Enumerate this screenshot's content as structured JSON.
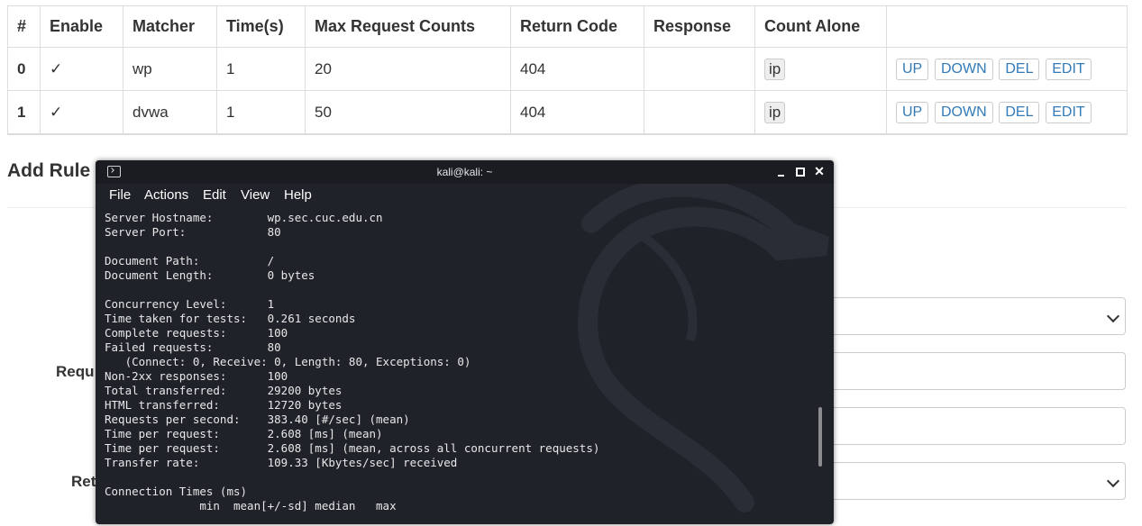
{
  "rules_table": {
    "headers": [
      "#",
      "Enable",
      "Matcher",
      "Time(s)",
      "Max Request Counts",
      "Return Code",
      "Response",
      "Count Alone",
      ""
    ],
    "rows": [
      {
        "index": "0",
        "enable": "✓",
        "matcher": "wp",
        "time": "1",
        "max_requests": "20",
        "return_code": "404",
        "response": "",
        "count_alone": "ip"
      },
      {
        "index": "1",
        "enable": "✓",
        "matcher": "dvwa",
        "time": "1",
        "max_requests": "50",
        "return_code": "404",
        "response": "",
        "count_alone": "ip"
      }
    ],
    "actions": {
      "up": "UP",
      "down": "DOWN",
      "del": "DEL",
      "edit": "EDIT"
    }
  },
  "form": {
    "title": "Add Rule",
    "label_request_partial": "Requ",
    "label_return_partial": "Ret"
  },
  "terminal": {
    "title": "kali@kali: ~",
    "menu": [
      "File",
      "Actions",
      "Edit",
      "View",
      "Help"
    ],
    "lines": [
      "Server Hostname:        wp.sec.cuc.edu.cn",
      "Server Port:            80",
      "",
      "Document Path:          /",
      "Document Length:        0 bytes",
      "",
      "Concurrency Level:      1",
      "Time taken for tests:   0.261 seconds",
      "Complete requests:      100",
      "Failed requests:        80",
      "   (Connect: 0, Receive: 0, Length: 80, Exceptions: 0)",
      "Non-2xx responses:      100",
      "Total transferred:      29200 bytes",
      "HTML transferred:       12720 bytes",
      "Requests per second:    383.40 [#/sec] (mean)",
      "Time per request:       2.608 [ms] (mean)",
      "Time per request:       2.608 [ms] (mean, across all concurrent requests)",
      "Transfer rate:          109.33 [Kbytes/sec] received",
      "",
      "Connection Times (ms)",
      "              min  mean[+/-sd] median   max"
    ]
  },
  "colors": {
    "terminal_bg": "#1f2229",
    "link_blue": "#337ab7",
    "table_border": "#dddddd"
  }
}
